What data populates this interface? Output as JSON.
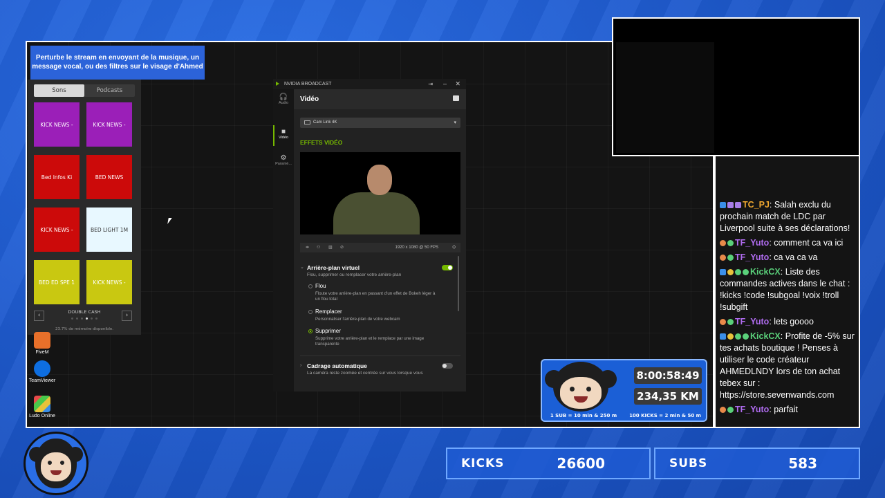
{
  "soundboard": {
    "banner": "Perturbe le stream en envoyant de la musique, un message vocal, ou des filtres sur le visage d'Ahmed",
    "tabs": [
      "Sons",
      "Podcasts"
    ],
    "buttons": [
      {
        "label": "KICK NEWS -",
        "color": "#9b1fb8"
      },
      {
        "label": "KICK NEWS -",
        "color": "#9b1fb8"
      },
      {
        "label": "Bed Infos Ki",
        "color": "#cc0a0a"
      },
      {
        "label": "BED NEWS",
        "color": "#cc0a0a"
      },
      {
        "label": "KICK NEWS -",
        "color": "#cc0a0a"
      },
      {
        "label": "BED LIGHT 1M",
        "color": "#e8f8ff"
      },
      {
        "label": "BED ED SPE 1",
        "color": "#c9c811"
      },
      {
        "label": "KICK NEWS -",
        "color": "#c9c811"
      }
    ],
    "page_name": "DOUBLE CASH",
    "memory": "23.7% de mémoire disponible."
  },
  "desktop_icons": [
    "FiveM",
    "TeamViewer",
    "Ludo Online"
  ],
  "nvidia": {
    "title": "NVIDIA BROADCAST",
    "sidebar": [
      "Audio",
      "Vidéo",
      "Paramè..."
    ],
    "section_title": "Vidéo",
    "device": "Cam Link 4K",
    "effects_title": "EFFETS VIDÉO",
    "resolution": "1920 x 1080 @ 50 FPS",
    "effect": {
      "name": "Arrière-plan virtuel",
      "desc": "Flou, supprimer ou remplacer votre arrière-plan",
      "enabled": true,
      "options": [
        {
          "name": "Flou",
          "desc": "Floute votre arrière-plan en passant d'un effet de Bokeh léger à un flou total",
          "selected": false
        },
        {
          "name": "Remplacer",
          "desc": "Personnaliser l'arrière-plan de votre webcam",
          "selected": false
        },
        {
          "name": "Supprimer",
          "desc": "Supprime votre arrière-plan et le remplace par une image transparente",
          "selected": true
        }
      ]
    },
    "effect2": {
      "name": "Cadrage automatique",
      "desc": "La caméra reste zoomée et centrée sur vous lorsque vous",
      "enabled": false
    }
  },
  "chat": [
    {
      "user": "TC_PJ",
      "color": "#f0a830",
      "badges": [
        "b-blue",
        "b-purple",
        "b-purple"
      ],
      "text": "Salah exclu du prochain match de LDC par Liverpool suite à ses déclarations!"
    },
    {
      "user": "TF_Yuto",
      "color": "#b06cf0",
      "badges": [
        "b-orange",
        "b-green"
      ],
      "text": "comment ca va ici"
    },
    {
      "user": "TF_Yuto",
      "color": "#b06cf0",
      "badges": [
        "b-orange",
        "b-green"
      ],
      "text": "ca va ca va"
    },
    {
      "user": "KickCX",
      "color": "#5ad07a",
      "badges": [
        "b-blue",
        "b-gold",
        "b-green",
        "b-green"
      ],
      "text": "Liste des commandes actives dans le chat : !kicks !code !subgoal !voix !troll !subgift"
    },
    {
      "user": "TF_Yuto",
      "color": "#b06cf0",
      "badges": [
        "b-orange",
        "b-green"
      ],
      "text": "lets goooo"
    },
    {
      "user": "KickCX",
      "color": "#5ad07a",
      "badges": [
        "b-blue",
        "b-gold",
        "b-green",
        "b-green"
      ],
      "text": "Profite de -5% sur tes achats boutique ! Penses à utiliser le code créateur AHMEDLNDY lors de ton achat tebex sur : https://store.sevenwands.com"
    },
    {
      "user": "TF_Yuto",
      "color": "#b06cf0",
      "badges": [
        "b-orange",
        "b-green"
      ],
      "text": "parfait"
    }
  ],
  "stats": {
    "timer": "8:00:58:49",
    "distance": "234,35 KM",
    "rule1": "1 SUB = 10 min & 250 m",
    "rule2": "100 KICKS = 2 min & 50 m"
  },
  "counters": {
    "kicks_label": "KICKS",
    "kicks_value": "26600",
    "subs_label": "SUBS",
    "subs_value": "583"
  }
}
